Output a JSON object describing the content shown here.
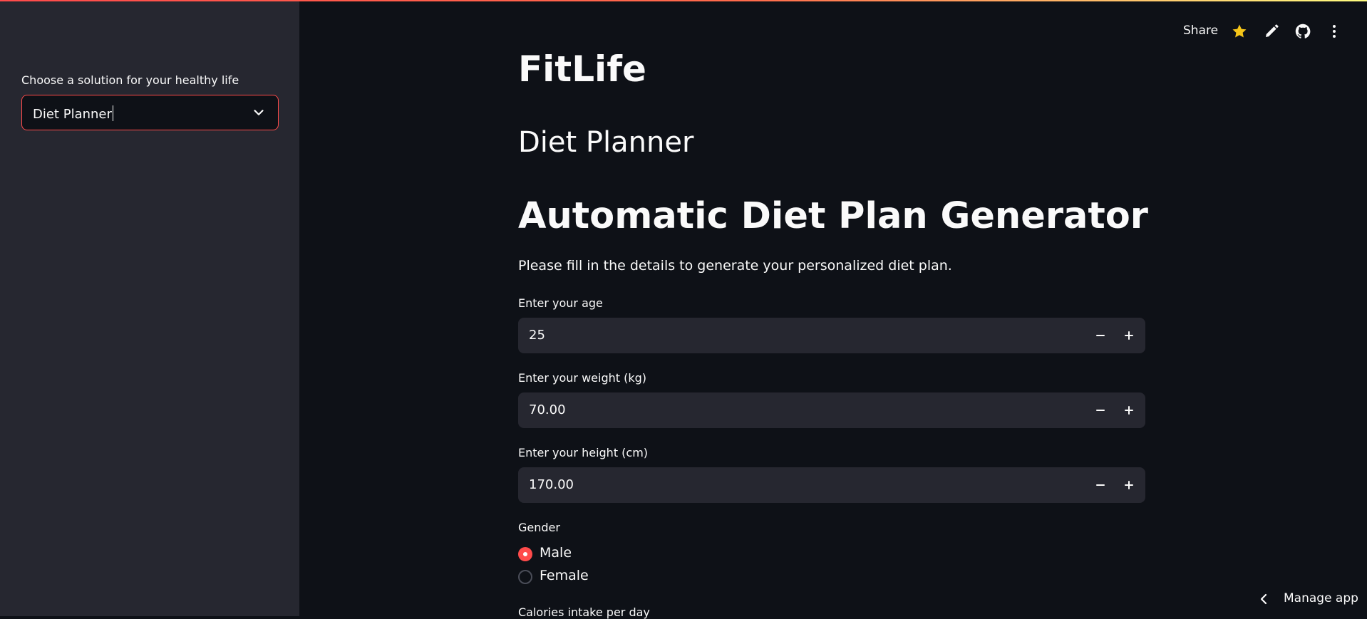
{
  "sidebar": {
    "select_label": "Choose a solution for your healthy life",
    "select_value": "Diet Planner"
  },
  "header": {
    "share_label": "Share",
    "icons": [
      "star-icon",
      "pencil-icon",
      "github-icon",
      "more-vertical-icon"
    ],
    "star_color": "#f5c518"
  },
  "main": {
    "title": "FitLife",
    "subtitle": "Diet Planner",
    "heading": "Automatic Diet Plan Generator",
    "description": "Please fill in the details to generate your personalized diet plan.",
    "fields": [
      {
        "label": "Enter your age",
        "value": "25"
      },
      {
        "label": "Enter your weight (kg)",
        "value": "70.00"
      },
      {
        "label": "Enter your height (cm)",
        "value": "170.00"
      }
    ],
    "gender": {
      "label": "Gender",
      "options": [
        "Male",
        "Female"
      ],
      "selected": "Male"
    },
    "next_label": "Calories intake per day"
  },
  "footer": {
    "manage_label": "Manage app"
  },
  "colors": {
    "accent": "#ff4b4b",
    "background": "#0e1117",
    "sidebar": "#262730",
    "input_bg": "#262730"
  }
}
